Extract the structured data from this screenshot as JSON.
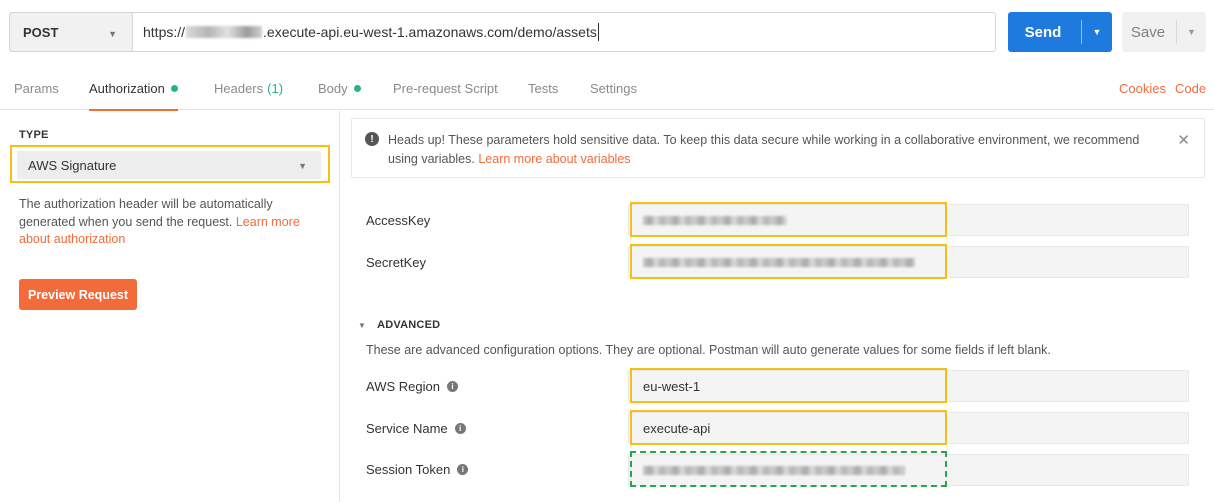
{
  "request": {
    "method": "POST",
    "url_prefix": "https://",
    "url_suffix": ".execute-api.eu-west-1.amazonaws.com/demo/assets",
    "send_label": "Send",
    "save_label": "Save"
  },
  "tabs": [
    {
      "label": "Params"
    },
    {
      "label": "Authorization",
      "active": true,
      "indicator": "green-dot"
    },
    {
      "label": "Headers",
      "count": "(1)"
    },
    {
      "label": "Body",
      "indicator": "green-dot"
    },
    {
      "label": "Pre-request Script"
    },
    {
      "label": "Tests"
    },
    {
      "label": "Settings"
    }
  ],
  "tab_links": {
    "cookies": "Cookies",
    "code": "Code"
  },
  "auth": {
    "type_label": "TYPE",
    "type_value": "AWS Signature",
    "description": "The authorization header will be automatically generated when you send the request.",
    "learn_more": "Learn more about authorization",
    "preview_button": "Preview Request"
  },
  "alert": {
    "icon": "exclamation-icon",
    "text": "Heads up! These parameters hold sensitive data. To keep this data secure while working in a collaborative environment, we recommend using variables.",
    "link": "Learn more about variables"
  },
  "fields": {
    "access_key": {
      "label": "AccessKey"
    },
    "secret_key": {
      "label": "SecretKey"
    },
    "aws_region": {
      "label": "AWS Region",
      "value": "eu-west-1"
    },
    "service_name": {
      "label": "Service Name",
      "value": "execute-api"
    },
    "session_token": {
      "label": "Session Token"
    }
  },
  "advanced": {
    "title": "ADVANCED",
    "description": "These are advanced configuration options. They are optional. Postman will auto generate values for some fields if left blank."
  },
  "colors": {
    "accent": "#f26b3a",
    "primary": "#1f7ae0",
    "highlight": "#f5bf18",
    "dashed_highlight": "#26a84a",
    "status_dot": "#26b47f"
  }
}
